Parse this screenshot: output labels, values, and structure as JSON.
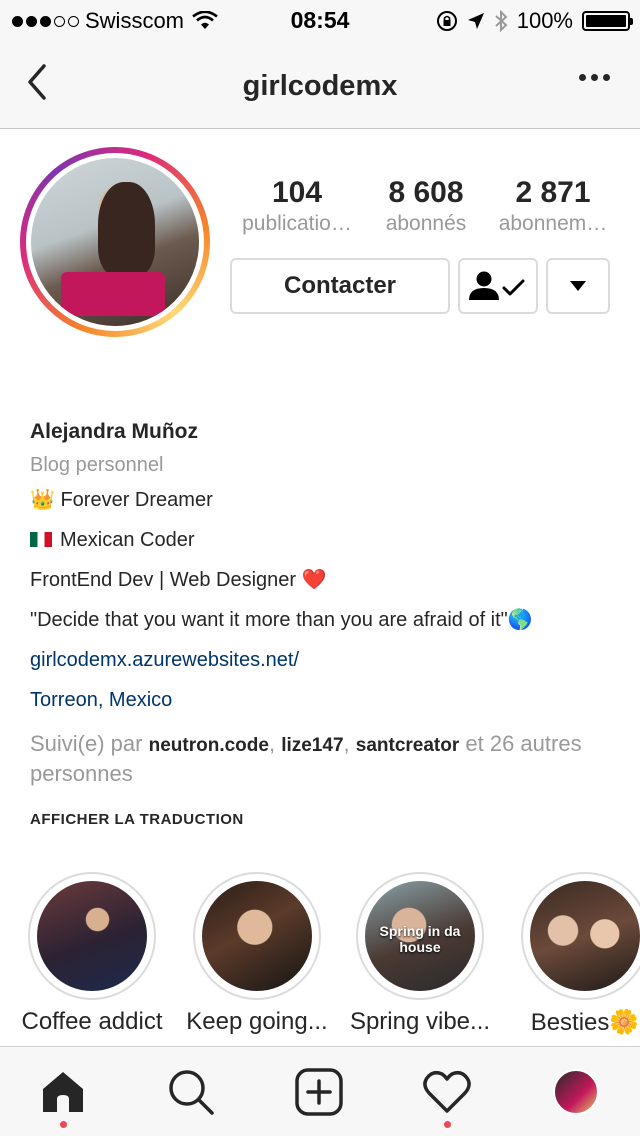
{
  "status_bar": {
    "carrier": "Swisscom",
    "time": "08:54",
    "battery": "100%"
  },
  "header": {
    "username": "girlcodemx"
  },
  "profile": {
    "stats": [
      {
        "value": "104",
        "label": "publicatio…"
      },
      {
        "value": "8 608",
        "label": "abonnés"
      },
      {
        "value": "2 871",
        "label": "abonnem…"
      }
    ],
    "contact_label": "Contacter"
  },
  "bio": {
    "name": "Alejandra Muñoz",
    "category": "Blog personnel",
    "line1": "Forever Dreamer",
    "line2": "Mexican Coder",
    "line3": "FrontEnd Dev | Web Designer",
    "line4": "\"Decide that you want it more than you are afraid of it\"",
    "website": "girlcodemx.azurewebsites.net/",
    "location": "Torreon, Mexico"
  },
  "followed_by": {
    "prefix": "Suivi(e) par",
    "users": [
      "neutron.code",
      "lize147",
      "santcreator"
    ],
    "suffix": "et 26 autres personnes"
  },
  "translate_label": "AFFICHER LA TRADUCTION",
  "highlights": [
    {
      "label": "Coffee addict"
    },
    {
      "label": "Keep going..."
    },
    {
      "label": "Spring vibe...",
      "overlay": "Spring in da house"
    },
    {
      "label": "Besties🌼"
    }
  ],
  "tabs": [
    "home",
    "search",
    "new-post",
    "activity",
    "profile"
  ],
  "colors": {
    "link": "#003569",
    "muted": "#999999",
    "notification_dot": "#ed4956"
  }
}
